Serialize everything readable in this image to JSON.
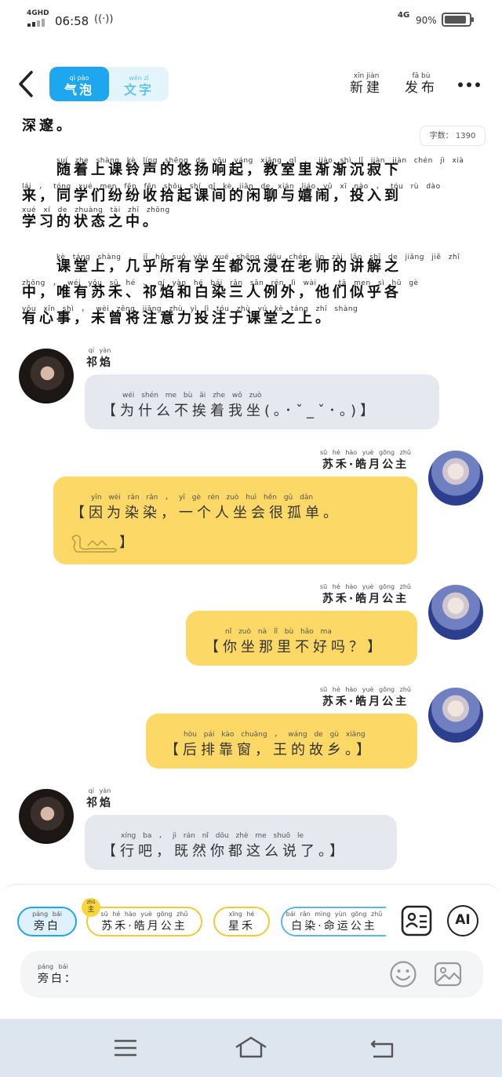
{
  "status_bar": {
    "network": "4GHD",
    "time": "06:58",
    "network_right": "4G",
    "battery": "90%",
    "battery_level": 0.9
  },
  "header": {
    "tabs": [
      {
        "pinyin": "qì pào",
        "label": "气泡"
      },
      {
        "pinyin": "wén zì",
        "label": "文字"
      }
    ],
    "new_action": {
      "pinyin": "xīn jiàn",
      "label": "新建"
    },
    "publish_action": {
      "pinyin": "fā bù",
      "label": "发布"
    },
    "icons": [
      "back-arrow-icon",
      "more-icon"
    ]
  },
  "word_count": {
    "pinyin": "zì shù",
    "label": "字数：",
    "value": "1390"
  },
  "narration": [
    {
      "text": "深邃。"
    },
    {
      "pinyin": "suí zhe shàng kè líng shēng de yōu yáng xiǎng qǐ ， jiào shì lǐ jiàn jiàn chén jì xià",
      "text": "　　随着上课铃声的悠扬响起，教室里渐渐沉寂下"
    },
    {
      "pinyin": "lái ， tóng xué men fēn fēn shōu shí qǐ kè jiān de xián liáo yǔ xī nào ， tóu rù dào",
      "text": "来，同学们纷纷收拾起课间的闲聊与嬉闹，投入到"
    },
    {
      "pinyin": "xué xí de zhuàng tài zhī zhōng",
      "text": "学习的状态之中。"
    },
    {
      "pinyin": "kè táng shàng ， jī hū suǒ yǒu xué shēng dōu chén jìn zài lǎo shī de jiǎng jiě zhī",
      "text": "　　课堂上，几乎所有学生都沉浸在老师的讲解之"
    },
    {
      "pinyin": "zhōng ， wéi yǒu sū hé 、 qí yàn hé bái rǎn sān rén lì wài ， tā men sì hū gè",
      "text": "中，唯有苏禾、祁焰和白染三人例外，他们似乎各"
    },
    {
      "pinyin": "yǒu xīn shì ， wèi zēng jiāng zhù yì lì tóu zhù yú kè táng zhī shàng",
      "text": "有心事，未曾将注意力投注于课堂之上。"
    }
  ],
  "messages": [
    {
      "speaker_pinyin": "qí yàn",
      "speaker": "祁焰",
      "pinyin": "wéi shén me bù āi zhe wǒ zuò",
      "text": "【为什么不挨着我坐(｡･ˇ_ˇ･｡)】"
    },
    {
      "speaker_pinyin": "sū hé hào yuè gōng zhǔ",
      "speaker": "苏禾·皓月公主",
      "pinyin": "yīn wèi rǎn rǎn ， yī gè rén zuò huì hěn gū dān",
      "text": "【因为染染，一个人坐会很孤单。",
      "text2": "】"
    },
    {
      "speaker_pinyin": "sū hé hào yuè gōng zhǔ",
      "speaker": "苏禾·皓月公主",
      "pinyin": "nǐ zuò nà lǐ bù hǎo ma",
      "text": "【你坐那里不好吗？】"
    },
    {
      "speaker_pinyin": "sū hé hào yuè gōng zhǔ",
      "speaker": "苏禾·皓月公主",
      "pinyin": "hòu pái kào chuāng ， wáng de gù xiāng",
      "text": "【后排靠窗，王的故乡。】"
    },
    {
      "speaker_pinyin": "qí yàn",
      "speaker": "祁焰",
      "pinyin": "xíng ba ， jì rán nǐ dōu zhè me shuō le",
      "text": "【行吧，既然你都这么说了。】"
    }
  ],
  "composer": {
    "roles": [
      {
        "pinyin": "páng bái",
        "label": "旁白"
      },
      {
        "pinyin": "sū hé hào yuè gōng zhǔ",
        "label": "苏禾·皓月公主"
      },
      {
        "pinyin": "xīng hé",
        "label": "星禾"
      },
      {
        "pinyin": "bái rǎn mìng yùn gōng zhǔ",
        "label": "白染·命运公主"
      }
    ],
    "protagonist_badge": {
      "pinyin": "zhǔ",
      "label": "主"
    },
    "ai_label": "AI",
    "input_label": {
      "pinyin": "páng bái",
      "label": "旁白："
    },
    "icons": [
      "role-card-icon",
      "ai-icon",
      "emoji-icon",
      "image-icon"
    ]
  },
  "nav": {
    "icons": [
      "menu-icon",
      "home-icon",
      "back-icon"
    ]
  },
  "colors": {
    "accent": "#1ea7ef",
    "bubble_right": "#fcd967",
    "bubble_left": "#e5e8ee",
    "nav_bg": "#dde6ef"
  }
}
